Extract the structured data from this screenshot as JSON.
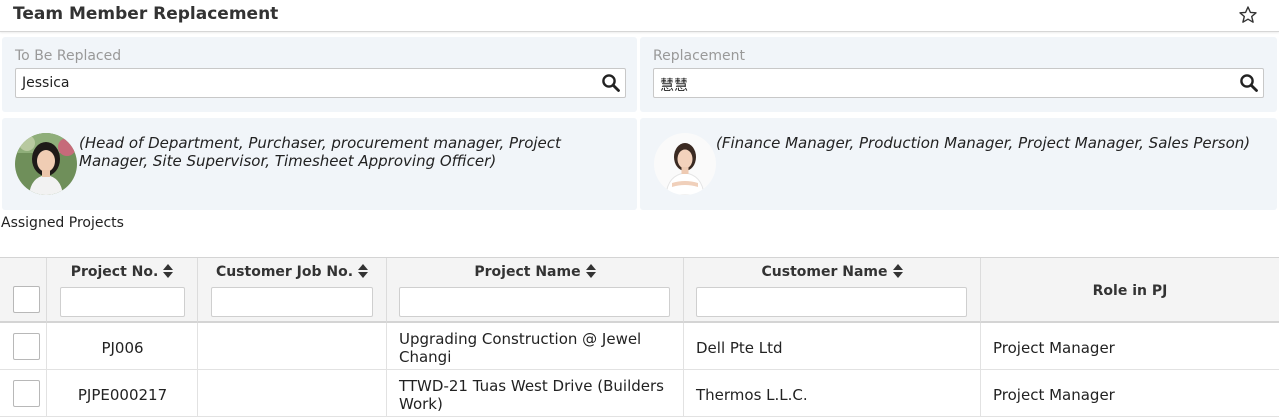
{
  "header": {
    "title": "Team Member Replacement",
    "star_icon": "star-outline-icon"
  },
  "to_be_replaced": {
    "label": "To Be Replaced",
    "value": "Jessica",
    "roles": "(Head of Department, Purchaser, procurement manager, Project Manager, Site Supervisor, Timesheet Approving Officer)"
  },
  "replacement": {
    "label": "Replacement",
    "value": "慧慧",
    "roles": "(Finance Manager, Production Manager, Project Manager, Sales Person)"
  },
  "assigned_projects": {
    "label": "Assigned Projects",
    "columns": [
      "Project No.",
      "Customer Job No.",
      "Project Name",
      "Customer Name",
      "Role in PJ"
    ],
    "rows": [
      {
        "project_no": "PJ006",
        "customer_job_no": "",
        "project_name": "Upgrading Construction @ Jewel Changi",
        "customer_name": "Dell Pte Ltd",
        "role": "Project Manager"
      },
      {
        "project_no": "PJPE000217",
        "customer_job_no": "",
        "project_name": "TTWD-21 Tuas West Drive (Builders Work)",
        "customer_name": "Thermos L.L.C.",
        "role": "Project Manager"
      }
    ]
  }
}
